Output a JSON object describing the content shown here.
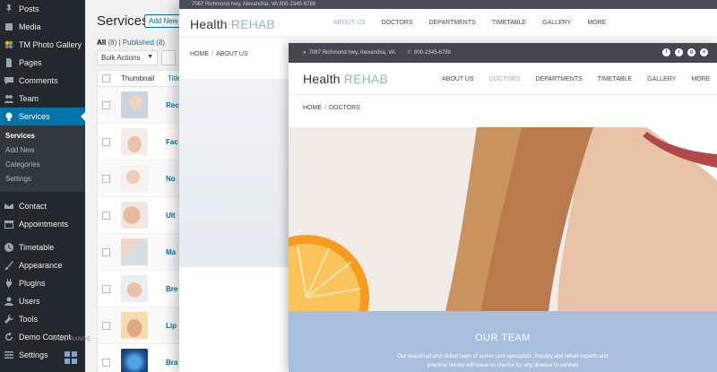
{
  "sidebar": {
    "items": [
      {
        "label": "Posts",
        "icon": "pin-icon"
      },
      {
        "label": "Media",
        "icon": "media-icon"
      },
      {
        "label": "TM Photo Gallery",
        "icon": "gallery-icon"
      },
      {
        "label": "Pages",
        "icon": "page-icon"
      },
      {
        "label": "Comments",
        "icon": "comment-icon"
      },
      {
        "label": "Team",
        "icon": "team-icon"
      },
      {
        "label": "Services",
        "icon": "lightbulb-icon"
      }
    ],
    "submenu": [
      "Services",
      "Add New",
      "Categories",
      "Settings"
    ],
    "items_after": [
      {
        "label": "Contact",
        "icon": "mail-icon"
      },
      {
        "label": "Appointments",
        "icon": "calendar-icon"
      },
      {
        "label": "Timetable",
        "icon": "clock-icon"
      },
      {
        "label": "Appearance",
        "icon": "brush-icon"
      },
      {
        "label": "Plugins",
        "icon": "plug-icon"
      },
      {
        "label": "Users",
        "icon": "user-icon"
      },
      {
        "label": "Tools",
        "icon": "wrench-icon"
      },
      {
        "label": "Demo Content",
        "icon": "refresh-icon"
      },
      {
        "label": "Settings",
        "icon": "settings-icon"
      }
    ],
    "accent_color": "#0073aa"
  },
  "wp": {
    "page_title": "Services",
    "add_new": "Add New",
    "filter_all": "All",
    "filter_all_count": "(8)",
    "filter_published": "Published",
    "filter_published_count": "(8)",
    "bulk_actions": "Bulk Actions",
    "col_thumbnail": "Thumbnail",
    "col_title": "Title",
    "rows": [
      "Rec",
      "Fac",
      "No",
      "Ult",
      "Ma",
      "Bre",
      "Lip",
      "Bra"
    ]
  },
  "back_site": {
    "topbar": "7087 Richmond hwy, Alexandria, VA      800-2345-6789",
    "logo_main": "Health",
    "logo_accent": "REHAB",
    "menu": [
      "ABOUT US",
      "DOCTORS",
      "DEPARTMENTS",
      "TIMETABLE",
      "GALLERY",
      "MORE"
    ],
    "active_menu": "ABOUT US",
    "crumb_home": "HOME",
    "crumb_current": "ABOUT US",
    "wide_range": "WIDE RANGE"
  },
  "front_site": {
    "address": "7087 Richmond hwy, Alexandria, VA",
    "phone": "800-2345-6789",
    "logo_main": "Health",
    "logo_accent": "REHAB",
    "menu": [
      "ABOUT US",
      "DOCTORS",
      "DEPARTMENTS",
      "TIMETABLE",
      "GALLERY",
      "MORE"
    ],
    "active_menu": "DOCTORS",
    "crumb_home": "HOME",
    "crumb_current": "DOCTORS",
    "team_title": "OUR TEAM",
    "team_text_1": "Our seasoned and skilled team of senior care specialists, therapy and rehab experts and",
    "team_text_2": "practical nurses will leave no chance for any disease to survive!",
    "accent_color": "#8bb3d9",
    "team_bg": "#a7bfdc"
  }
}
